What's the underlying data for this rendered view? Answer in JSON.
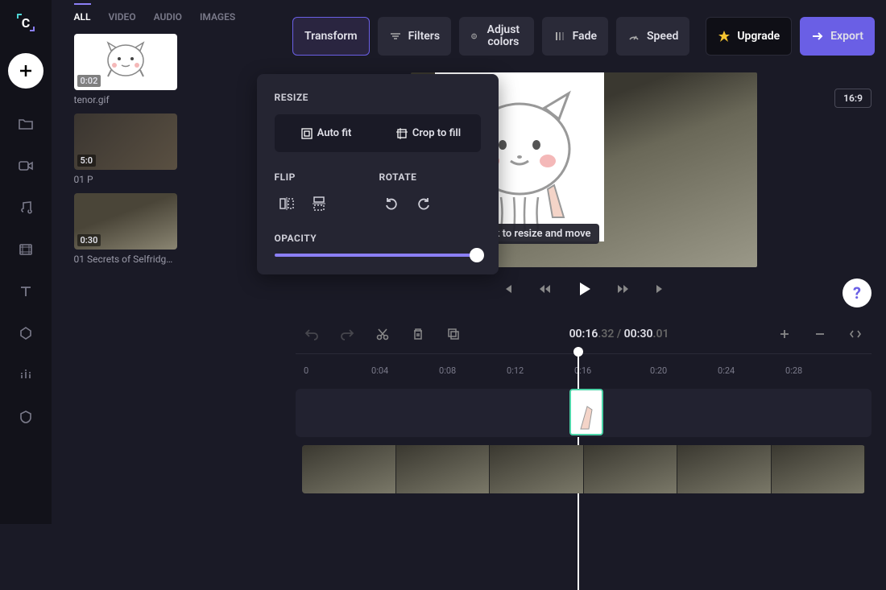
{
  "sidebar": {
    "logo_letter": "C"
  },
  "media_panel": {
    "tabs": [
      "ALL",
      "VIDEO",
      "AUDIO",
      "IMAGES"
    ],
    "items": [
      {
        "duration": "0:02",
        "name": "tenor.gif",
        "kind": "cat"
      },
      {
        "duration": "5:0",
        "name": "01 P",
        "kind": "video"
      },
      {
        "duration": "0:30",
        "name": "01 Secrets of Selfridges…",
        "kind": "video"
      }
    ]
  },
  "transform_panel": {
    "resize_label": "RESIZE",
    "auto_fit": "Auto fit",
    "crop_fill": "Crop to fill",
    "flip_label": "FLIP",
    "rotate_label": "ROTATE",
    "opacity_label": "OPACITY",
    "opacity_value": 100
  },
  "topbar": {
    "transform": "Transform",
    "filters": "Filters",
    "adjust_colors": "Adjust colors",
    "fade": "Fade",
    "speed": "Speed",
    "upgrade": "Upgrade",
    "export": "Export"
  },
  "preview": {
    "aspect": "16:9",
    "tooltip": "Click to resize and move"
  },
  "playback": {
    "current": "00:16",
    "current_frames": ".32",
    "sep": " / ",
    "total": "00:30",
    "total_frames": ".01"
  },
  "timeline": {
    "ticks": [
      "0",
      "0:04",
      "0:08",
      "0:12",
      "0:16",
      "0:20",
      "0:24",
      "0:28"
    ]
  }
}
